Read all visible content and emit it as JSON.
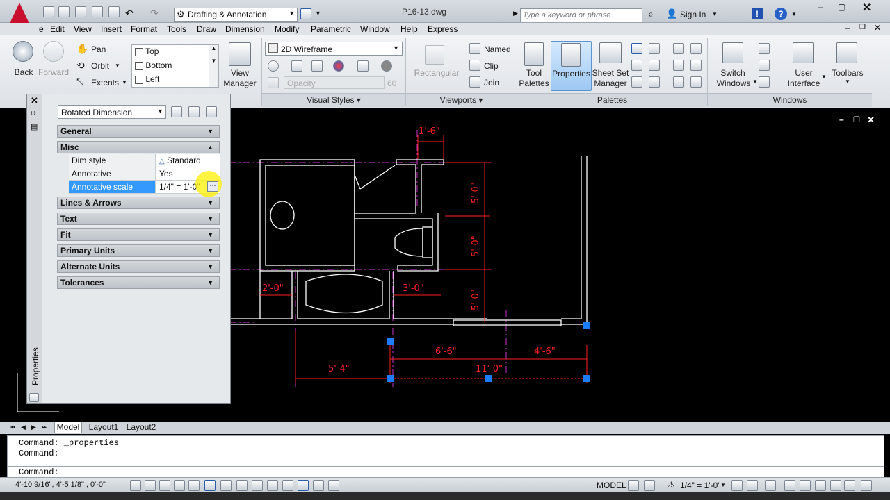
{
  "title_bar": {
    "workspace": "Drafting & Annotation",
    "filename": "P16-13.dwg",
    "search_placeholder": "Type a keyword or phrase",
    "sign_in": "Sign In"
  },
  "menu": [
    "e",
    "Edit",
    "View",
    "Insert",
    "Format",
    "Tools",
    "Draw",
    "Dimension",
    "Modify",
    "Parametric",
    "Window",
    "Help",
    "Express"
  ],
  "ribbon": {
    "back": "Back",
    "forward": "Forward",
    "pan": "Pan",
    "orbit": "Orbit",
    "extents": "Extents",
    "views": [
      "Top",
      "Bottom",
      "Left"
    ],
    "view_manager_1": "View",
    "view_manager_2": "Manager",
    "visual_style": "2D Wireframe",
    "opacity_label": "Opacity",
    "opacity_value": "60",
    "rectangular": "Rectangular",
    "named": "Named",
    "clip": "Clip",
    "join": "Join",
    "tool_palettes_1": "Tool",
    "tool_palettes_2": "Palettes",
    "properties": "Properties",
    "sheet_set_1": "Sheet Set",
    "sheet_set_2": "Manager",
    "switch_windows_1": "Switch",
    "switch_windows_2": "Windows",
    "user_interface_1": "User",
    "user_interface_2": "Interface",
    "toolbars": "Toolbars",
    "groups": {
      "visual_styles": "Visual Styles",
      "viewports": "Viewports",
      "palettes": "Palettes",
      "windows": "Windows"
    }
  },
  "properties_panel": {
    "object_type": "Rotated Dimension",
    "sections": [
      "General",
      "Misc",
      "Lines & Arrows",
      "Text",
      "Fit",
      "Primary Units",
      "Alternate Units",
      "Tolerances"
    ],
    "misc_rows": [
      {
        "key": "Dim style",
        "value": "Standard"
      },
      {
        "key": "Annotative",
        "value": "Yes"
      },
      {
        "key": "Annotative scale",
        "value": "1/4\" = 1'-0\""
      }
    ],
    "vertical_title": "Properties"
  },
  "dimensions": {
    "d1": "1'-6\"",
    "d2": "5'-0\"",
    "d3": "5'-0\"",
    "d4": "5'-0\"",
    "d5": "2'-0\"",
    "d6": "3'-0\"",
    "d7": "6'-6\"",
    "d8": "4'-6\"",
    "d9": "5'-4\"",
    "d10": "11'-0\""
  },
  "tabs": [
    "Model",
    "Layout1",
    "Layout2"
  ],
  "command": {
    "line1": "Command:  _properties",
    "line2": "Command:",
    "prompt": "Command:"
  },
  "status": {
    "coords": "4'-10 9/16\", 4'-5 1/8\" , 0'-0\"",
    "model": "MODEL",
    "scale": "1/4\" = 1'-0\""
  },
  "colors": {
    "dim_red": "#ff2020",
    "wall_white": "#ffffff",
    "center_magenta": "#cc33cc",
    "grip_blue": "#1e7cff",
    "highlight": "#3399ff"
  }
}
